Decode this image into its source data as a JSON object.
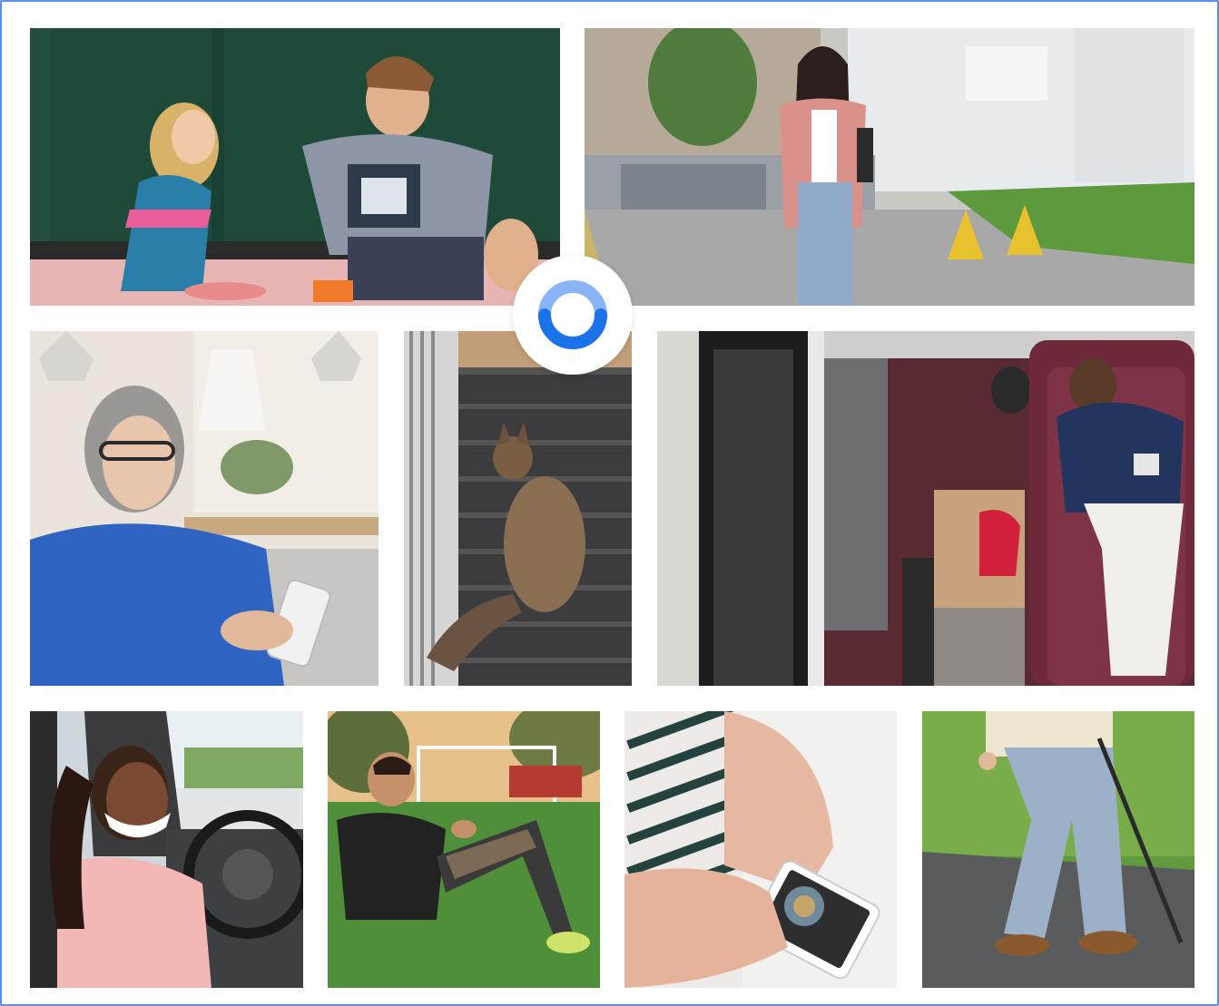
{
  "collage": {
    "photos": [
      {
        "name": "photo-children-playing",
        "icon": "children-photo"
      },
      {
        "name": "photo-woman-walking-campus",
        "icon": "woman-walking-photo"
      },
      {
        "name": "photo-woman-with-phone-sofa",
        "icon": "woman-phone-photo"
      },
      {
        "name": "photo-cat-on-stairs",
        "icon": "cat-photo"
      },
      {
        "name": "photo-man-sleeping-couch",
        "icon": "man-sleeping-photo"
      },
      {
        "name": "photo-woman-driving",
        "icon": "driver-photo"
      },
      {
        "name": "photo-man-checking-watch-field",
        "icon": "fitness-photo"
      },
      {
        "name": "photo-hands-holding-phone",
        "icon": "phone-app-photo"
      },
      {
        "name": "photo-person-walking-cane",
        "icon": "cane-walking-photo"
      }
    ]
  },
  "logo": {
    "icon": "ring-logo-icon",
    "colors": {
      "primary": "#1a73e8",
      "light": "#8ab4f8"
    }
  },
  "colors": {
    "border": "#5b8def",
    "background": "#ffffff"
  }
}
